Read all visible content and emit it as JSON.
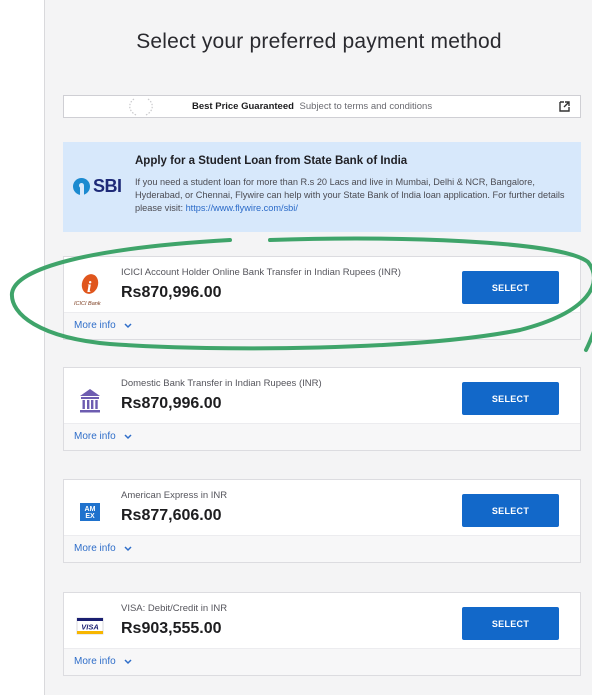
{
  "title": "Select your preferred payment method",
  "banner": {
    "bold": "Best Price Guaranteed",
    "sub": "Subject to terms and conditions"
  },
  "sbi": {
    "logo": "SBI",
    "heading": "Apply for a Student Loan from State Bank of India",
    "body": "If you need a student loan for more than R.s 20 Lacs and live in Mumbai, Delhi & NCR, Bangalore, Hyderabad, or Chennai, Flywire can help with your State Bank of India loan application. For further details please visit: ",
    "link": "https://www.flywire.com/sbi/"
  },
  "methods": [
    {
      "name": "ICICI Account Holder Online Bank Transfer in Indian Rupees (INR)",
      "amount": "Rs870,996.00",
      "button": "SELECT",
      "more": "More info",
      "icon": "icici-logo-icon",
      "icon_label": "ICICI Bank"
    },
    {
      "name": "Domestic Bank Transfer in Indian Rupees (INR)",
      "amount": "Rs870,996.00",
      "button": "SELECT",
      "more": "More info",
      "icon": "bank-icon"
    },
    {
      "name": "American Express in INR",
      "amount": "Rs877,606.00",
      "button": "SELECT",
      "more": "More info",
      "icon": "amex-icon",
      "icon_label": "AM EX"
    },
    {
      "name": "VISA: Debit/Credit in INR",
      "amount": "Rs903,555.00",
      "button": "SELECT",
      "more": "More info",
      "icon": "visa-icon",
      "icon_label": "VISA"
    }
  ],
  "colors": {
    "select_button": "#1268c9",
    "highlight": "#3fa46a",
    "sbi_banner": "#d7e8fb"
  }
}
